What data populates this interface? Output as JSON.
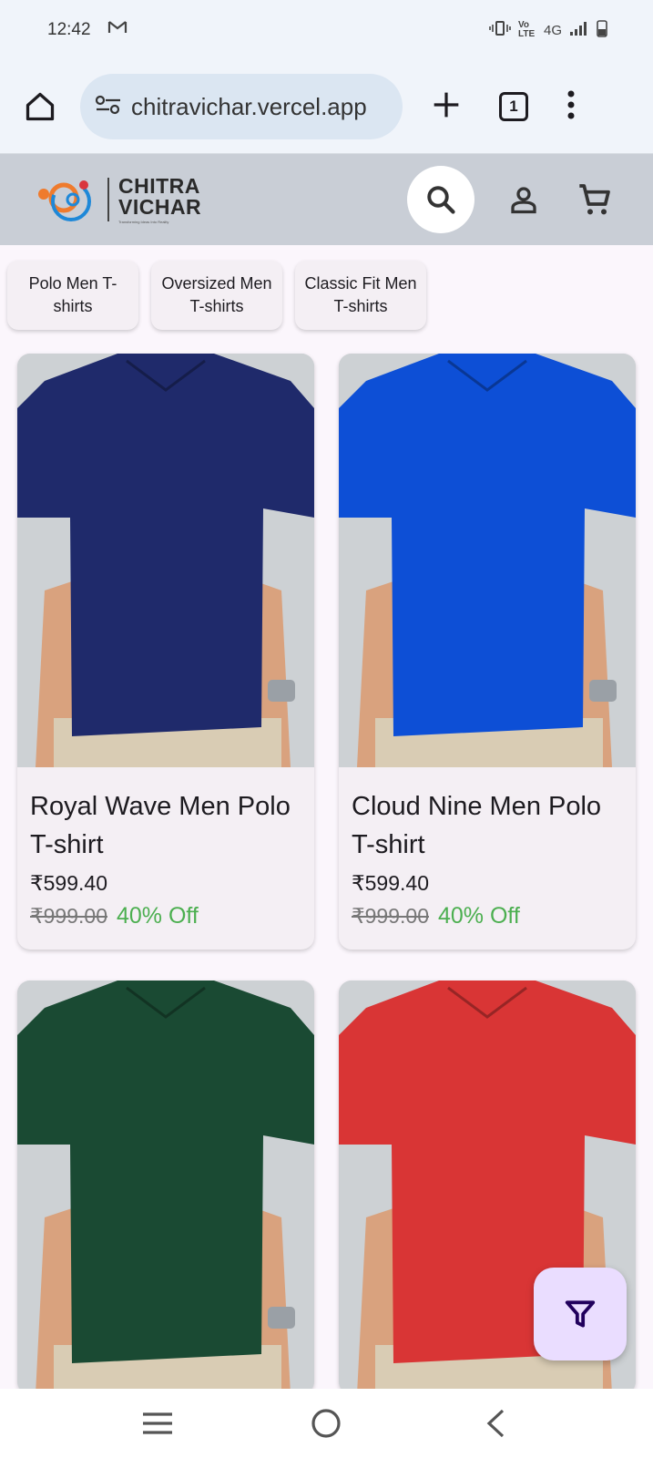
{
  "status_bar": {
    "time": "12:42",
    "network": "4G",
    "volte": "Vo LTE"
  },
  "browser": {
    "url": "chitravichar.vercel.app",
    "tab_count": "1"
  },
  "site": {
    "logo_line1": "CHITRA",
    "logo_line2": "VICHAR",
    "logo_tagline": "Transforming Ideas Into Reality"
  },
  "chips": [
    {
      "label": "Polo Men T-shirts"
    },
    {
      "label": "Oversized Men T-shirts"
    },
    {
      "label": "Classic Fit Men T-shirts"
    }
  ],
  "products": [
    {
      "name": "Royal Wave Men Polo T-shirt",
      "price": "₹599.40",
      "mrp": "₹999.00",
      "discount": "40% Off",
      "shirt_color": "#1f2a6b"
    },
    {
      "name": "Cloud Nine Men Polo T-shirt",
      "price": "₹599.40",
      "mrp": "₹999.00",
      "discount": "40% Off",
      "shirt_color": "#0d4fd6"
    },
    {
      "name": "",
      "price": "",
      "mrp": "",
      "discount": "",
      "shirt_color": "#1a4a33"
    },
    {
      "name": "",
      "price": "",
      "mrp": "",
      "discount": "",
      "shirt_color": "#d93535"
    }
  ],
  "colors": {
    "header_bg": "#c9ced6",
    "discount_green": "#4caf50",
    "fab_bg": "#eaddff"
  }
}
